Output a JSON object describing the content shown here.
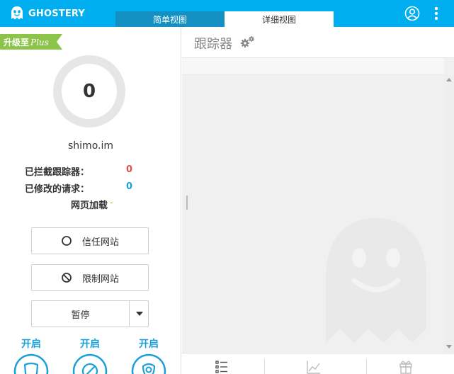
{
  "header": {
    "logo_text": "GHOSTERY",
    "tabs": [
      {
        "label": "简单视图",
        "active": false
      },
      {
        "label": "详细视图",
        "active": true
      }
    ],
    "brand_color": "#00aef0"
  },
  "left": {
    "upgrade": {
      "prefix": "升级至",
      "plus": "Plus"
    },
    "blocked_count": "0",
    "domain": "shimo.im",
    "stats": {
      "blocked_label": "已拦截跟踪器：",
      "blocked_value": "0",
      "modified_label": "已修改的请求：",
      "modified_value": "0",
      "page_load_label": "网页加载",
      "page_load_value": "-"
    },
    "trust_button": "信任网站",
    "restrict_button": "限制网站",
    "pause_button": "暂停",
    "features": [
      {
        "label": "开启",
        "icon": "shield-icon"
      },
      {
        "label": "开启",
        "icon": "block-icon"
      },
      {
        "label": "开启",
        "icon": "smart-shield-icon"
      }
    ]
  },
  "right": {
    "title": "跟踪器",
    "bottom_icons": [
      "list-icon",
      "chart-icon",
      "gift-icon"
    ]
  }
}
